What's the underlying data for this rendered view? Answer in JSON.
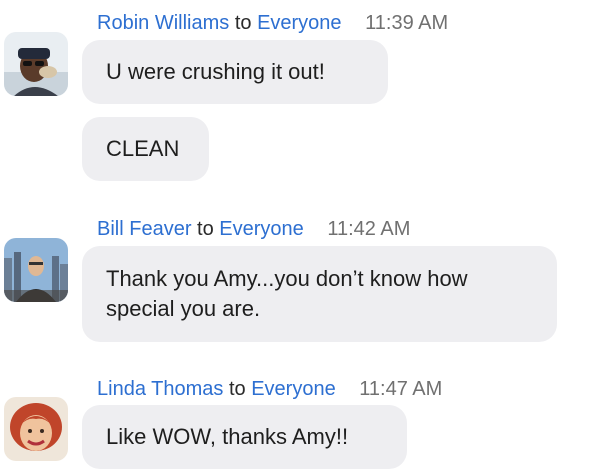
{
  "messages": [
    {
      "sender": "Robin Williams",
      "to_word": "to",
      "recipient": "Everyone",
      "time": "11:39 AM",
      "bubbles": [
        "U were crushing it out!",
        "CLEAN"
      ]
    },
    {
      "sender": "Bill Feaver",
      "to_word": "to",
      "recipient": "Everyone",
      "time": "11:42 AM",
      "bubbles": [
        "Thank you Amy...you don’t know how special you are."
      ]
    },
    {
      "sender": "Linda Thomas",
      "to_word": "to",
      "recipient": "Everyone",
      "time": "11:47 AM",
      "bubbles": [
        "Like WOW, thanks Amy!!"
      ]
    }
  ],
  "colors": {
    "name_link": "#2d6fd1",
    "bubble_bg": "#eeeef1",
    "timestamp": "#707070"
  },
  "icons": [
    "avatar-photo",
    "avatar-photo",
    "avatar-photo"
  ]
}
